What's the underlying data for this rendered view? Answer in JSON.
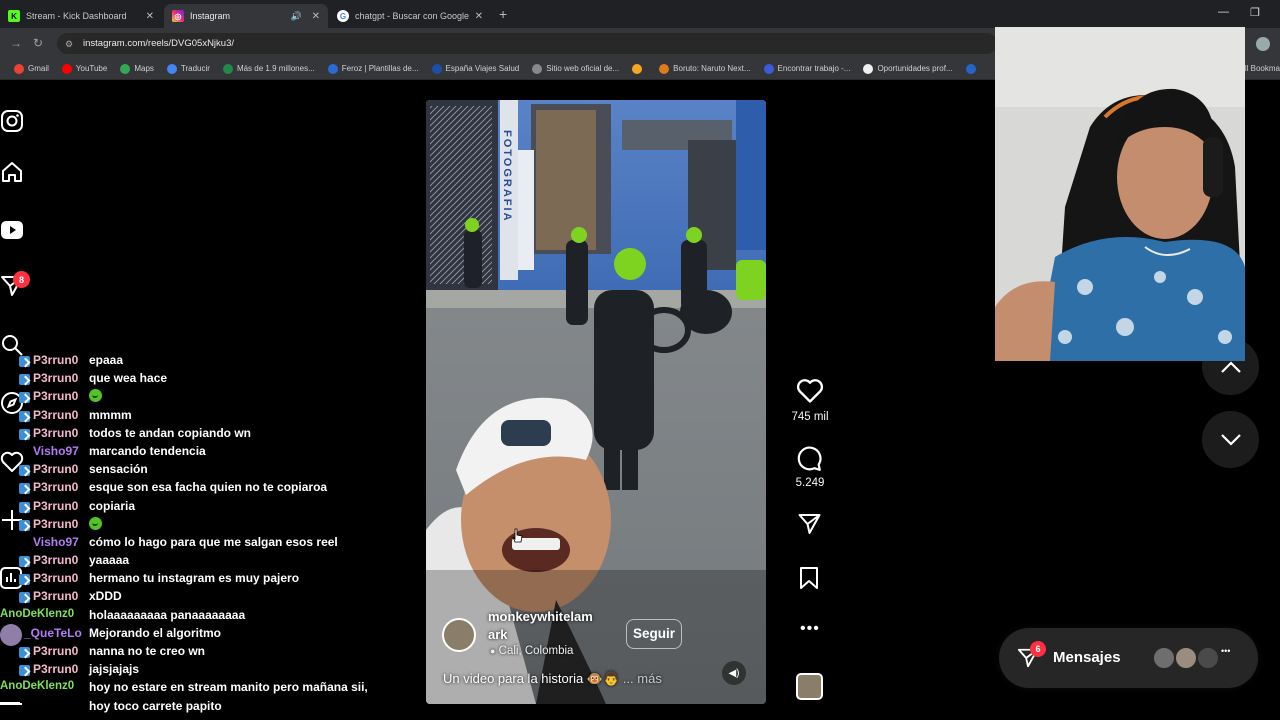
{
  "browser": {
    "tabs": [
      {
        "title": "Stream - Kick Dashboard",
        "favicon": "kick-icon",
        "active": false
      },
      {
        "title": "Instagram",
        "favicon": "instagram-icon",
        "active": true
      },
      {
        "title": "chatgpt - Buscar con Google",
        "favicon": "google-icon",
        "active": false
      }
    ],
    "url": "instagram.com/reels/DVG05xNjku3/",
    "bookmarks": [
      {
        "label": "Gmail",
        "color": "#ea4335"
      },
      {
        "label": "YouTube",
        "color": "#ff0000"
      },
      {
        "label": "Maps",
        "color": "#34a853"
      },
      {
        "label": "Traducir",
        "color": "#4285f4"
      },
      {
        "label": "Más de 1.9 millones...",
        "color": "#1f8a4c"
      },
      {
        "label": "Feroz | Plantillas de...",
        "color": "#2c6bd6"
      },
      {
        "label": "España Viajes Salud",
        "color": "#1d4fa8"
      },
      {
        "label": "Sitio web oficial de...",
        "color": "#888888"
      },
      {
        "label": "",
        "color": "#f5a623"
      },
      {
        "label": "Boruto: Naruto Next...",
        "color": "#e07a1f"
      },
      {
        "label": "Encontrar trabajo -...",
        "color": "#3b5bdb"
      },
      {
        "label": "Oportunidades prof...",
        "color": "#f0f0f0"
      },
      {
        "label": "",
        "color": "#2864c8"
      }
    ],
    "all_bookmarks": "All Bookma"
  },
  "sidebar": {
    "notification_count": "8"
  },
  "reel": {
    "author": "monkeywhitelam\nark",
    "author_line1": "monkeywhitelam",
    "author_line2": "ark",
    "follow_label": "Seguir",
    "location": "Cali, Colombia",
    "caption": "Un video para la historia",
    "more_label": "... más",
    "video_overlay_text": "FOTOGRAFIA",
    "likes": "745 mil",
    "comments": "5.249"
  },
  "messages_widget": {
    "label": "Mensajes",
    "count": "6"
  },
  "chat": [
    {
      "user": "P3rrun0",
      "text": "epaaa",
      "color": "#f5b7cf",
      "badge": true
    },
    {
      "user": "P3rrun0",
      "text": "que wea hace",
      "color": "#f5b7cf",
      "badge": true
    },
    {
      "user": "P3rrun0",
      "text": "",
      "emote": true,
      "color": "#f5b7cf",
      "badge": true
    },
    {
      "user": "P3rrun0",
      "text": "mmmm",
      "color": "#f5b7cf",
      "badge": true
    },
    {
      "user": "P3rrun0",
      "text": "todos te andan copiando wn",
      "color": "#f5b7cf",
      "badge": true
    },
    {
      "user": "Visho97",
      "text": "marcando tendencia",
      "color": "#b57cf5",
      "badge": false
    },
    {
      "user": "P3rrun0",
      "text": "sensación",
      "color": "#f5b7cf",
      "badge": true
    },
    {
      "user": "P3rrun0",
      "text": "esque son esa facha quien no te copiaroa",
      "color": "#f5b7cf",
      "badge": true
    },
    {
      "user": "P3rrun0",
      "text": "copiaria",
      "color": "#f5b7cf",
      "badge": true
    },
    {
      "user": "P3rrun0",
      "text": "",
      "emote": true,
      "color": "#f5b7cf",
      "badge": true
    },
    {
      "user": "Visho97",
      "text": "cómo lo hago para que me salgan esos reel",
      "color": "#b57cf5",
      "badge": false
    },
    {
      "user": "P3rrun0",
      "text": "yaaaaa",
      "color": "#f5b7cf",
      "badge": true
    },
    {
      "user": "P3rrun0",
      "text": "hermano tu instagram es muy pajero",
      "color": "#f5b7cf",
      "badge": true
    },
    {
      "user": "P3rrun0",
      "text": "xDDD",
      "color": "#f5b7cf",
      "badge": true
    },
    {
      "user": "AnoDeKlenz0",
      "text": "holaaaaaaaaa panaaaaaaaa",
      "color": "#7ee05a",
      "badge": false
    },
    {
      "user": "_QueTeLo",
      "text": "Mejorando el algoritmo",
      "color": "#b57cf5",
      "badge": false,
      "avatar": true
    },
    {
      "user": "P3rrun0",
      "text": "nanna no te creo wn",
      "color": "#f5b7cf",
      "badge": true
    },
    {
      "user": "P3rrun0",
      "text": "jajsjajajs",
      "color": "#f5b7cf",
      "badge": true
    },
    {
      "user": "AnoDeKlenz0",
      "text": "hoy no estare en stream manito pero mañana sii,",
      "color": "#7ee05a",
      "badge": false
    },
    {
      "user": "",
      "text": "hoy toco carrete papito",
      "color": "#7ee05a",
      "badge": false
    }
  ]
}
